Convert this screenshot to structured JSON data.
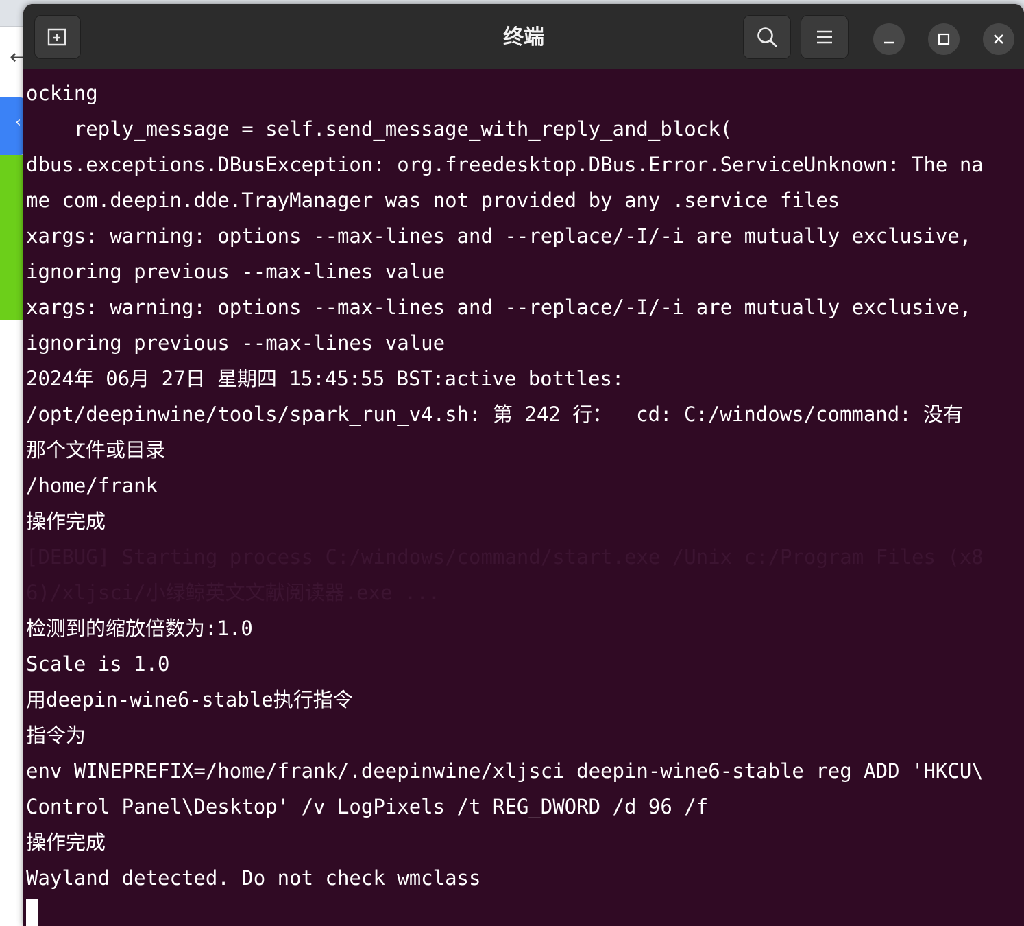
{
  "window": {
    "title": "终端"
  },
  "icons": {
    "new_tab": "new-tab-icon",
    "search": "search-icon",
    "menu": "hamburger-menu-icon",
    "minimize": "minimize-icon",
    "maximize": "maximize-icon",
    "close": "close-icon"
  },
  "colors": {
    "terminal_bg": "#300a24",
    "headerbar_bg": "#2c2c2c",
    "text": "#ffffff",
    "faded_text": "#3c1431"
  },
  "terminal": {
    "lines": [
      {
        "text": "ocking",
        "dim": false
      },
      {
        "text": "    reply_message = self.send_message_with_reply_and_block(",
        "dim": false
      },
      {
        "text": "dbus.exceptions.DBusException: org.freedesktop.DBus.Error.ServiceUnknown: The na",
        "dim": false
      },
      {
        "text": "me com.deepin.dde.TrayManager was not provided by any .service files",
        "dim": false
      },
      {
        "text": "xargs: warning: options --max-lines and --replace/-I/-i are mutually exclusive,",
        "dim": false
      },
      {
        "text": "ignoring previous --max-lines value",
        "dim": false
      },
      {
        "text": "xargs: warning: options --max-lines and --replace/-I/-i are mutually exclusive,",
        "dim": false
      },
      {
        "text": "ignoring previous --max-lines value",
        "dim": false
      },
      {
        "text": "2024年 06月 27日 星期四 15:45:55 BST:active bottles:",
        "dim": false
      },
      {
        "text": "/opt/deepinwine/tools/spark_run_v4.sh: 第 242 行：  cd: C:/windows/command: 没有",
        "dim": false
      },
      {
        "text": "那个文件或目录",
        "dim": false
      },
      {
        "text": "/home/frank",
        "dim": false
      },
      {
        "text": "操作完成",
        "dim": false
      },
      {
        "text": "[DEBUG] Starting process C:/windows/command/start.exe /Unix c:/Program Files (x8",
        "dim": true
      },
      {
        "text": "6)/xljsci/小绿鲸英文文献阅读器.exe ...",
        "dim": true
      },
      {
        "text": "检测到的缩放倍数为:1.0",
        "dim": false
      },
      {
        "text": "Scale is 1.0",
        "dim": false
      },
      {
        "text": "用deepin-wine6-stable执行指令",
        "dim": false
      },
      {
        "text": "指令为",
        "dim": false
      },
      {
        "text": "env WINEPREFIX=/home/frank/.deepinwine/xljsci deepin-wine6-stable reg ADD 'HKCU\\",
        "dim": false
      },
      {
        "text": "Control Panel\\Desktop' /v LogPixels /t REG_DWORD /d 96 /f",
        "dim": false
      },
      {
        "text": "操作完成",
        "dim": false
      },
      {
        "text": "Wayland detected. Do not check wmclass",
        "dim": false
      }
    ]
  }
}
